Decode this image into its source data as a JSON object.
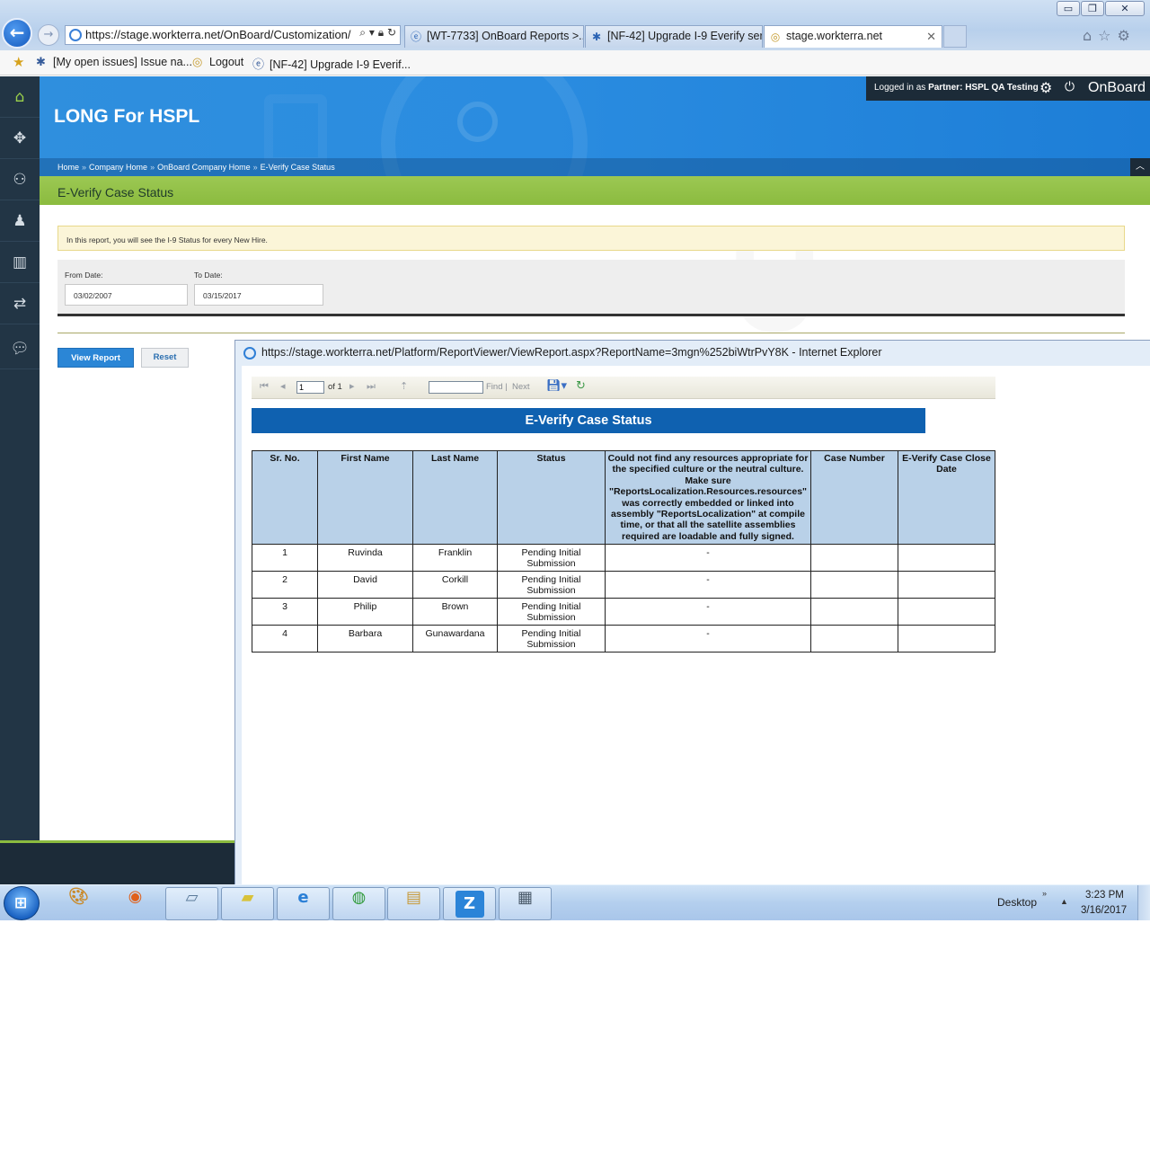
{
  "browser": {
    "window_controls": {
      "minimize": "▭",
      "restore": "❐",
      "close": "✕"
    },
    "address": "https://stage.workterra.net/OnBoard/Customization/",
    "tabs": [
      {
        "label": "[WT-7733] OnBoard Reports >...",
        "icon": "ie-page-icon"
      },
      {
        "label": "[NF-42] Upgrade I-9 Everify ser...",
        "icon": "jira-icon"
      },
      {
        "label": "stage.workterra.net",
        "icon": "workterra-icon",
        "close": "✕"
      }
    ],
    "favorites": [
      {
        "label": "[My open issues] Issue na...",
        "icon": "jira-icon"
      },
      {
        "label": "Logout",
        "icon": "workterra-icon"
      },
      {
        "label": "[NF-42] Upgrade I-9 Everif...",
        "icon": "ie-page-icon"
      }
    ]
  },
  "app": {
    "company_title": "LONG For HSPL",
    "userbar": {
      "logged_in_prefix": "Logged in as",
      "partner_label": "Partner:",
      "partner_name": "HSPL QA Testing",
      "brand": "OnBoard"
    },
    "breadcrumb": [
      "Home",
      "Company Home",
      "OnBoard Company Home",
      "E-Verify Case Status"
    ],
    "breadcrumb_sep": "»",
    "page_title": "E-Verify Case Status",
    "info_text": "In this report, you will see the I-9 Status for every New Hire.",
    "filters": {
      "from_label": "From Date:",
      "from_value": "03/02/2007",
      "to_label": "To Date:",
      "to_value": "03/15/2017"
    },
    "buttons": {
      "view_report": "View Report",
      "reset": "Reset"
    }
  },
  "popup": {
    "title": "https://stage.workterra.net/Platform/ReportViewer/ViewReport.aspx?ReportName=3mgn%252biWtrPvY8K - Internet Explorer",
    "toolbar": {
      "page": "1",
      "of_label": "of 1",
      "find_label": "Find",
      "next_label": "Next",
      "pipe": "|"
    },
    "report_title": "E-Verify Case Status",
    "table": {
      "columns": [
        "Sr. No.",
        "First Name",
        "Last Name",
        "Status",
        "Could not find any resources appropriate for the specified culture or the neutral culture.  Make sure \"ReportsLocalization.Resources.resources\" was correctly embedded or linked into assembly \"ReportsLocalization\" at compile time, or that all the satellite assemblies required are loadable and fully signed.",
        "Case Number",
        "E-Verify Case Close Date"
      ],
      "rows": [
        [
          "1",
          "Ruvinda",
          "Franklin",
          "Pending Initial Submission",
          "-",
          "",
          ""
        ],
        [
          "2",
          "David",
          "Corkill",
          "Pending Initial Submission",
          "-",
          "",
          ""
        ],
        [
          "3",
          "Philip",
          "Brown",
          "Pending Initial Submission",
          "-",
          "",
          ""
        ],
        [
          "4",
          "Barbara",
          "Gunawardana",
          "Pending Initial Submission",
          "-",
          "",
          ""
        ]
      ]
    }
  },
  "taskbar": {
    "desktop_label": "Desktop",
    "time": "3:23 PM",
    "date": "3/16/2017",
    "apps": [
      "paint-icon",
      "firefox-icon",
      "window-icon",
      "sticky-notes-icon",
      "internet-explorer-icon",
      "chrome-icon",
      "file-explorer-icon",
      "z-app-icon",
      "calculator-icon"
    ]
  }
}
